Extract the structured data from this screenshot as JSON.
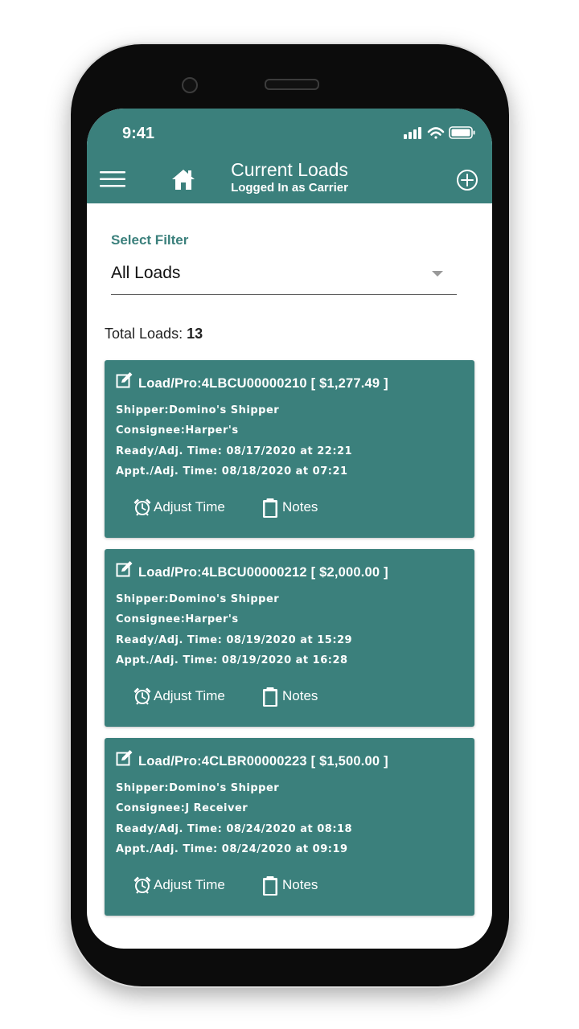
{
  "status_bar": {
    "time": "9:41"
  },
  "header": {
    "title": "Current Loads",
    "subtitle": "Logged In as Carrier"
  },
  "filter": {
    "label": "Select Filter",
    "value": "All Loads"
  },
  "summary": {
    "label": "Total Loads:",
    "count": "13"
  },
  "actions": {
    "adjust_label": "Adjust Time",
    "notes_label": "Notes"
  },
  "loads": [
    {
      "title": "Load/Pro:4LBCU00000210 [ $1,277.49 ]",
      "shipper": "Shipper:Domino's Shipper",
      "consignee": "Consignee:Harper's",
      "ready": "Ready/Adj. Time: 08/17/2020 at 22:21",
      "appt": "Appt./Adj. Time: 08/18/2020 at 07:21"
    },
    {
      "title": "Load/Pro:4LBCU00000212 [ $2,000.00 ]",
      "shipper": "Shipper:Domino's Shipper",
      "consignee": "Consignee:Harper's",
      "ready": "Ready/Adj. Time: 08/19/2020 at 15:29",
      "appt": "Appt./Adj. Time: 08/19/2020 at 16:28"
    },
    {
      "title": "Load/Pro:4CLBR00000223 [ $1,500.00 ]",
      "shipper": "Shipper:Domino's Shipper",
      "consignee": "Consignee:J Receiver",
      "ready": "Ready/Adj. Time: 08/24/2020 at 08:18",
      "appt": "Appt./Adj. Time: 08/24/2020 at 09:19"
    }
  ],
  "colors": {
    "brand": "#3b807c",
    "text_on_brand": "#ffffff"
  },
  "icons": {
    "menu": "hamburger-menu-icon",
    "home": "home-icon",
    "add": "add-circle-icon",
    "edit": "edit-icon",
    "alarm": "alarm-clock-icon",
    "notes": "clipboard-icon"
  }
}
